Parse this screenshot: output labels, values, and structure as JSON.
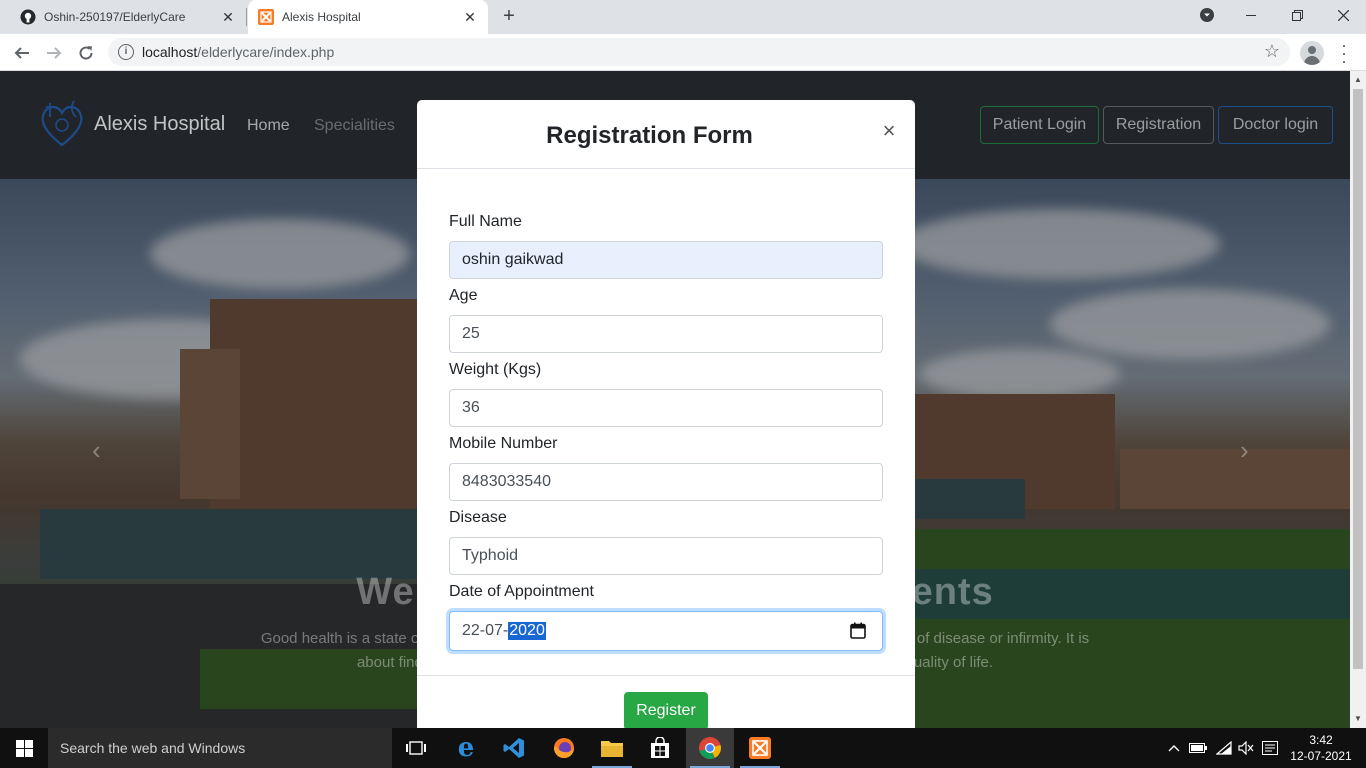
{
  "browser": {
    "tabs": [
      {
        "title": "Oshin-250197/ElderlyCare",
        "icon": "github-icon",
        "active": false
      },
      {
        "title": "Alexis Hospital",
        "icon": "xampp-icon",
        "active": true
      }
    ],
    "new_tab": "+",
    "url_host": "localhost",
    "url_path": "/elderlycare/index.php"
  },
  "site": {
    "brand": "Alexis Hospital",
    "nav": {
      "home": "Home",
      "specialities": "Specialities"
    },
    "buttons": {
      "patient_login": "Patient Login",
      "registration": "Registration",
      "doctor_login": "Doctor login"
    },
    "hero_title": "We                                          ients",
    "hero_line1": "Good health is a state of com                                                                                                    sence of disease or infirmity. It is",
    "hero_line2": "about finding a                                                                                                   g the quality of life."
  },
  "modal": {
    "title": "Registration Form",
    "close": "×",
    "fields": {
      "full_name": {
        "label": "Full Name",
        "value": "oshin gaikwad"
      },
      "age": {
        "label": "Age",
        "value": "25"
      },
      "weight": {
        "label": "Weight (Kgs)",
        "value": "36"
      },
      "mobile": {
        "label": "Mobile Number",
        "value": "8483033540"
      },
      "disease": {
        "label": "Disease",
        "value": "Typhoid"
      },
      "appointment": {
        "label": "Date of Appointment",
        "value_prefix": "22-07-",
        "value_selected": "2020"
      }
    },
    "submit": "Register"
  },
  "taskbar": {
    "search_placeholder": "Search the web and Windows",
    "time": "3:42",
    "date": "12-07-2021"
  },
  "colors": {
    "register_green": "#28a745",
    "autofill_bg": "#e8f0fe",
    "selection_blue": "#1967d2"
  }
}
